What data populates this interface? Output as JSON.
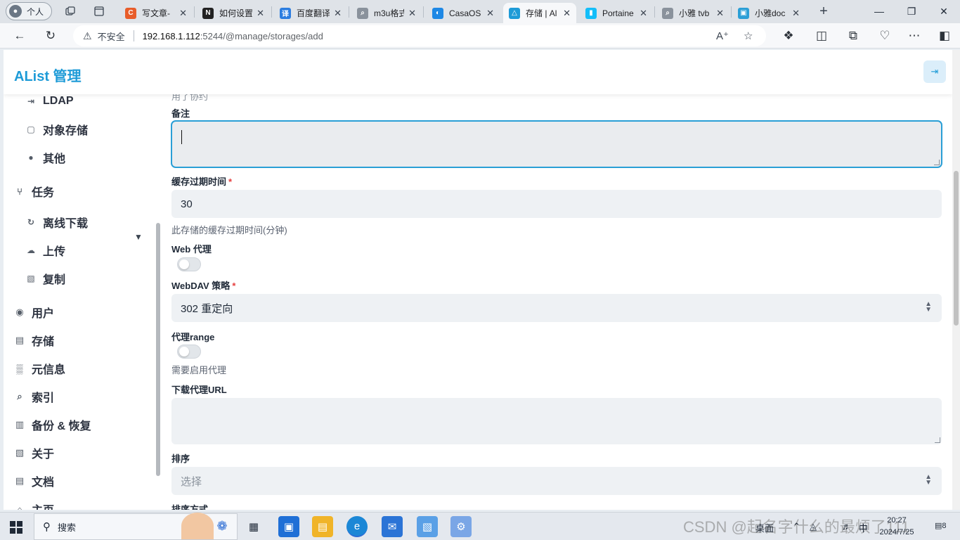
{
  "browser": {
    "profile_label": "个人",
    "profile_avatar": "●",
    "tabs": [
      {
        "title": "写文章-",
        "favicon_text": "C",
        "favicon_color": "#e85d2a"
      },
      {
        "title": "如何设置",
        "favicon_text": "N",
        "favicon_color": "#222222"
      },
      {
        "title": "百度翻译",
        "favicon_text": "译",
        "favicon_color": "#2b7de0"
      },
      {
        "title": "m3u格式",
        "favicon_text": "⌕",
        "favicon_color": "#8a929c"
      },
      {
        "title": "CasaOS",
        "favicon_text": "◐",
        "favicon_color": "#1e88e5"
      },
      {
        "title": "存储 | Al",
        "favicon_text": "△",
        "favicon_color": "#1e9bd7"
      },
      {
        "title": "Portaine",
        "favicon_text": "▮",
        "favicon_color": "#13bef9"
      },
      {
        "title": "小雅 tvb",
        "favicon_text": "⌕",
        "favicon_color": "#8a929c"
      },
      {
        "title": "小雅doc",
        "favicon_text": "▣",
        "favicon_color": "#2b9fd6"
      }
    ],
    "active_tab_index": 5,
    "address": {
      "security_text": "不安全",
      "host": "192.168.1.112",
      "rest": ":5244/@manage/storages/add"
    },
    "icons": {
      "workspaces": "workspaces-icon",
      "tab_actions": "tab-actions-icon",
      "new_tab": "+",
      "minimize": "—",
      "restore": "❐",
      "close": "✕"
    }
  },
  "app": {
    "title": "AList 管理",
    "logout_icon": "⇥"
  },
  "sidebar": {
    "items": [
      {
        "label": "LDAP",
        "icon": "⇥",
        "level": "sub"
      },
      {
        "label": "对象存储",
        "icon": "▢",
        "level": "sub"
      },
      {
        "label": "其他",
        "icon": "●",
        "level": "sub"
      },
      {
        "label": "任务",
        "icon": "⑂",
        "level": "group",
        "expanded": true
      },
      {
        "label": "离线下载",
        "icon": "↻",
        "level": "sub"
      },
      {
        "label": "上传",
        "icon": "☁",
        "level": "sub"
      },
      {
        "label": "复制",
        "icon": "▧",
        "level": "sub"
      },
      {
        "label": "用户",
        "icon": "◉",
        "level": "top"
      },
      {
        "label": "存储",
        "icon": "▤",
        "level": "top"
      },
      {
        "label": "元信息",
        "icon": "▒",
        "level": "top"
      },
      {
        "label": "索引",
        "icon": "⌕",
        "level": "top"
      },
      {
        "label": "备份 & 恢复",
        "icon": "▥",
        "level": "top"
      },
      {
        "label": "关于",
        "icon": "▧",
        "level": "top"
      },
      {
        "label": "文档",
        "icon": "▤",
        "level": "top"
      },
      {
        "label": "主页",
        "icon": "⌂",
        "level": "top"
      }
    ]
  },
  "form": {
    "cut_top_label": "用了协约",
    "remark": {
      "label": "备注",
      "value": ""
    },
    "cache_expiration": {
      "label": "缓存过期时间",
      "value": "30",
      "help": "此存储的缓存过期时间(分钟)"
    },
    "web_proxy": {
      "label": "Web 代理",
      "enabled": false
    },
    "webdav_policy": {
      "label": "WebDAV 策略",
      "selected": "302 重定向"
    },
    "proxy_range": {
      "label": "代理range",
      "enabled": false,
      "help": "需要启用代理"
    },
    "download_proxy_url": {
      "label": "下载代理URL",
      "value": ""
    },
    "order": {
      "label": "排序",
      "placeholder": "选择"
    },
    "order_direction": {
      "label": "排序方式"
    }
  },
  "taskbar": {
    "search_label": "搜索",
    "watermark": "CSDN @起名字什么的最烦了111",
    "tray_text": "桌面",
    "ime": "中",
    "time": "20:27",
    "date": "2024/7/25",
    "notifications": "8"
  }
}
